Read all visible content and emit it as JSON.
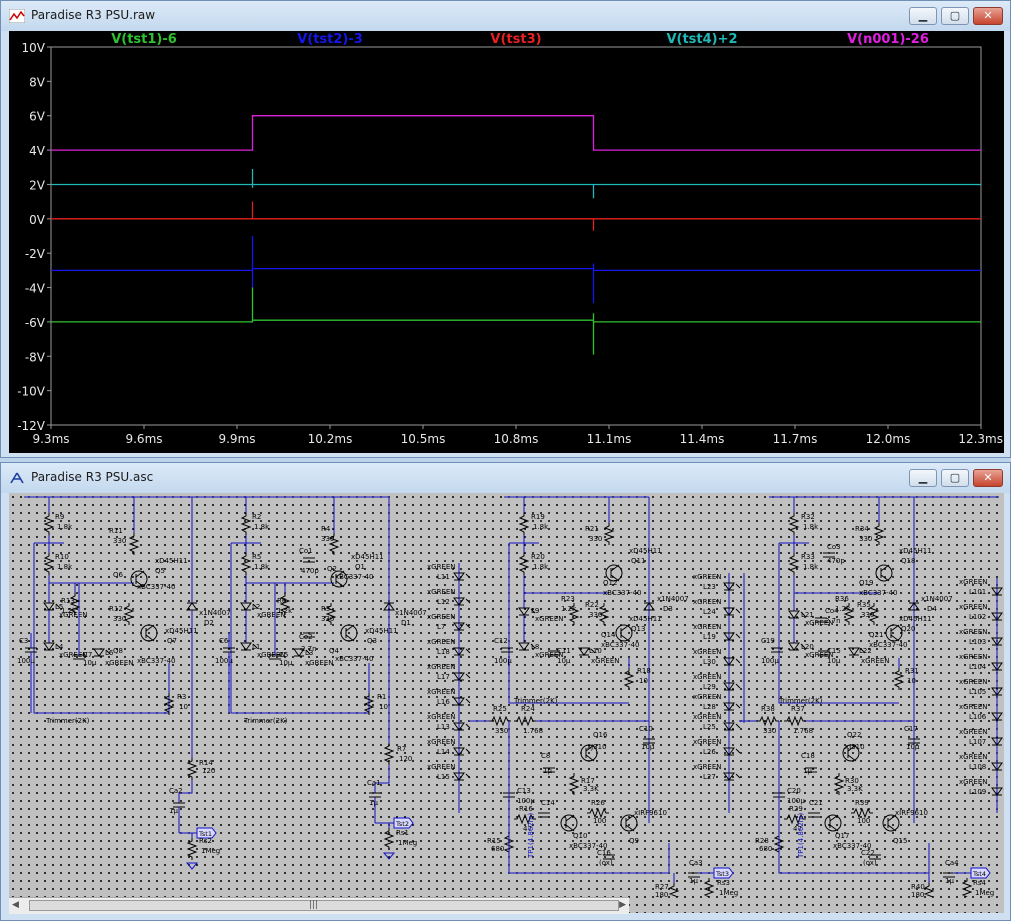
{
  "waveform_window": {
    "title": "Paradise R3 PSU.raw",
    "buttons": {
      "minimize": "▁",
      "maximize": "▢",
      "close": "✕"
    }
  },
  "schematic_window": {
    "title": "Paradise R3 PSU.asc",
    "buttons": {
      "minimize": "▁",
      "maximize": "▢",
      "close": "✕"
    },
    "labels": {
      "r9": "R9",
      "r9v": "1.8k",
      "r10": "R10",
      "r10v": "1.8k",
      "r11": "R11",
      "r11v": "330",
      "q5": "xD45H11",
      "q5n": "Q5",
      "q6": "Q6",
      "q6m": "xBC337-40",
      "r13": "R13",
      "r13v": "1.2k",
      "r12": "R12",
      "r12v": "330",
      "q7": "xD45H11",
      "q7n": "Q7",
      "q8": "Q8",
      "q8m": "xBC337-40",
      "d2": "x1N4007",
      "d2n": "D2",
      "l5": "L5",
      "l5m": "xGREEN",
      "c3": "C3",
      "c3v": "100µ",
      "l4": "L4",
      "l4m": "xGREEN",
      "c7": "C7",
      "c7v": "10µ",
      "l6": "L6",
      "l6m": "xGREEN",
      "r3": "R3",
      "r3v": "10",
      "trim1": "Trimmer(2K)",
      "r14": "R14",
      "r14v": "120",
      "ca2": "Ca2",
      "ca2v": "1µ",
      "rs2": "Rs2",
      "rs2v": "1Meg",
      "tst1": "Tst1",
      "r2": "R2",
      "r2v": "1.8k",
      "r5": "R5",
      "r5v": "1.8k",
      "r4": "R4",
      "r4v": "330",
      "co1": "Co1",
      "co1v": "470p",
      "q2": "Q2",
      "q2m": "xBC337-40",
      "q1": "xD45H11",
      "q1n": "Q1",
      "r6": "R6",
      "r6v": "1.2k",
      "r5b": "R5",
      "r5bv": "330",
      "co2": "Co2",
      "co2v": "2.7n",
      "q4": "Q4",
      "q4m": "xBC337-40",
      "q3": "xD45H11",
      "q3n": "Q3",
      "d1": "x1N4007",
      "d1n": "D1",
      "l2": "L2",
      "l2m": "xGREEN",
      "c6": "C6",
      "c6v": "100µ",
      "l1": "L1",
      "l1m": "xGREEN",
      "c5": "C5",
      "c5v": "10µ",
      "l3": "L3",
      "l3m": "xGREEN",
      "r1": "R1",
      "r1v": "10",
      "trim2": "Trimmer(2K)",
      "r7": "R7",
      "r7v": "120",
      "ca1": "Ca1",
      "ca1v": "1µ",
      "rs1": "Rs1",
      "rs1v": "1Meg",
      "tst2": "Tst2",
      "xg": "xGREEN",
      "l11": "L11",
      "l12": "L12",
      "l7": "L7",
      "l18": "L18",
      "l17": "L17",
      "l16": "L16",
      "l13": "L13",
      "l14": "L14",
      "l15": "L15",
      "r19": "R19",
      "r19v": "1.8k",
      "r20": "R20",
      "r20v": "1.8k",
      "r21": "R21",
      "r21v": "330",
      "q11": "xD45H11",
      "q11n": "Q11",
      "q12": "Q12",
      "q12m": "xBC337-40",
      "r23": "R23",
      "r23v": "1.2k",
      "r22": "R22",
      "r22v": "330",
      "q13": "xD45H11",
      "q13n": "Q13",
      "q14": "Q14",
      "q14m": "xBC337-40",
      "d3": "x1N4007",
      "d3n": "D3",
      "l9": "L9",
      "l9m": "xGREEN",
      "c12": "C12",
      "c12v": "100µ",
      "l8": "L8",
      "l8m": "xGREEN",
      "c11": "C11",
      "c11v": "10µ",
      "l10": "L10",
      "l10m": "xGREEN",
      "r18": "R18",
      "r18v": "10",
      "trim3": "Trimmer(2K)",
      "r25": "R25",
      "r25v": "330",
      "r24": "R24",
      "r24v": "1.768",
      "c10": "C10",
      "c10v": "10µ",
      "q16": "Q16",
      "q16m": "xJ310",
      "c8": "C8",
      "c8v": "1µ",
      "r17": "R17",
      "r17v": "3.3K",
      "c13": "C13",
      "c13v": "100µ",
      "c14": "C14",
      "r26": "R26",
      "r26v": "100",
      "q10": "Q10",
      "q10m": "xBC337-40",
      "q9": "Q9",
      "q9m": "xIRF9610",
      "r16": "R16",
      "r16v": "47",
      "r15": "R15",
      "r15v": "680",
      "c16": "C16",
      "c16v": "(ox)",
      "tp1": "TP1(4.862m)",
      "r27": "R27",
      "r27v": "180",
      "ca3": "Ca3",
      "ca3v": "1µ",
      "rs3": "Rs3",
      "rs3v": "1Meg",
      "tst3": "Tst3",
      "l23": "L23",
      "l24": "L24",
      "l19": "L19",
      "l30": "L30",
      "l29": "L29",
      "l28": "L28",
      "l25": "L25",
      "l26": "L26",
      "l27": "L27",
      "r32": "R32",
      "r32v": "1.8k",
      "r33": "R33",
      "r33v": "1.8k",
      "r34": "R34",
      "r34v": "330",
      "co3": "Co3",
      "co3v": "470p",
      "q19": "Q19",
      "q19m": "xBC337-40",
      "q18": "xD45H11",
      "q18n": "Q18",
      "r36": "R36",
      "r36v": "1.2k",
      "r35": "R35",
      "r35v": "330",
      "co4": "Co4",
      "co4v": "2.7n",
      "q21": "Q21",
      "q21m": "xBC337-40",
      "q20": "xD45H11",
      "q20n": "Q20",
      "d4": "x1N4007",
      "d4n": "D4",
      "l21": "L21",
      "l21m": "xGREEN",
      "c19": "C19",
      "c19v": "100µ",
      "l20": "L20",
      "l20m": "xGREEN",
      "c15": "C15",
      "c15v": "10µ",
      "l22": "L22",
      "l22m": "xGREEN",
      "r31": "R31",
      "r31v": "10",
      "trim4": "Trimmer(2K)",
      "r38": "R38",
      "r38v": "330",
      "r37": "R37",
      "r37v": "1.768",
      "c17": "C17",
      "c17v": "10µ",
      "q22": "Q22",
      "q22m": "xJ310",
      "c18": "C18",
      "c18v": "1µ",
      "r30": "R30",
      "r30v": "3.3K",
      "c20": "C20",
      "c20v": "100µ",
      "c21": "C21",
      "r39": "R39",
      "r39v": "100",
      "q17": "Q17",
      "q17m": "xBC337-40",
      "q15": "Q15",
      "q15m": "xIRF9610",
      "r29": "R29",
      "r29v": "47",
      "r28": "R28",
      "r28v": "680",
      "c22": "C22",
      "c22v": "(ox)",
      "tp2": "TP1(4.862m)",
      "r40": "R40",
      "r40v": "180",
      "ca4": "Ca4",
      "ca4v": "1µ",
      "rs4": "Rs4",
      "rs4v": "1Meg",
      "tst4": "Tst4",
      "l101": "L101",
      "l102": "L102",
      "l103": "L103",
      "l104": "L104",
      "l105": "L105",
      "l106": "L106",
      "l107": "L107",
      "l108": "L108",
      "l109": "L109"
    }
  },
  "chart_data": {
    "type": "line",
    "background": "#000000",
    "xlim": [
      9.3,
      12.3
    ],
    "ylim": [
      -12,
      10
    ],
    "x_unit": "ms",
    "y_unit": "V",
    "x_ticks": [
      "9.3ms",
      "9.6ms",
      "9.9ms",
      "10.2ms",
      "10.5ms",
      "10.8ms",
      "11.1ms",
      "11.4ms",
      "11.7ms",
      "12.0ms",
      "12.3ms"
    ],
    "x_tick_values": [
      9.3,
      9.6,
      9.9,
      10.2,
      10.5,
      10.8,
      11.1,
      11.4,
      11.7,
      12.0,
      12.3
    ],
    "y_ticks": [
      "10V",
      "8V",
      "6V",
      "4V",
      "2V",
      "0V",
      "-2V",
      "-4V",
      "-6V",
      "-8V",
      "-10V",
      "-12V"
    ],
    "y_tick_values": [
      10,
      8,
      6,
      4,
      2,
      0,
      -2,
      -4,
      -6,
      -8,
      -10,
      -12
    ],
    "grid": false,
    "legend_position": "top",
    "series": [
      {
        "name": "V(tst1)-6",
        "color": "#2ec22e",
        "x": [
          9.3,
          9.95,
          9.95,
          9.95,
          9.95,
          11.05,
          11.05,
          11.05,
          11.05,
          12.3
        ],
        "y": [
          -6,
          -6,
          -4,
          -6,
          -5.9,
          -5.9,
          -5.5,
          -7.9,
          -6,
          -6
        ]
      },
      {
        "name": "V(tst2)-3",
        "color": "#1515ee",
        "x": [
          9.3,
          9.95,
          9.95,
          9.95,
          9.95,
          11.05,
          11.05,
          11.05,
          11.05,
          12.3
        ],
        "y": [
          -3,
          -3,
          -1,
          -4,
          -2.9,
          -2.9,
          -2.6,
          -4.9,
          -3,
          -3
        ]
      },
      {
        "name": "V(tst3)",
        "color": "#e82020",
        "x": [
          9.3,
          9.95,
          9.95,
          9.95,
          9.95,
          11.05,
          11.05,
          11.05,
          11.05,
          12.3
        ],
        "y": [
          0,
          0,
          1,
          0,
          0,
          0,
          0,
          -0.7,
          0,
          0
        ]
      },
      {
        "name": "V(tst4)+2",
        "color": "#20b8b8",
        "x": [
          9.3,
          9.95,
          9.95,
          9.95,
          9.95,
          11.05,
          11.05,
          11.05,
          11.05,
          12.3
        ],
        "y": [
          2,
          2,
          2.9,
          1.8,
          2,
          2,
          2,
          1.2,
          2,
          2
        ]
      },
      {
        "name": "V(n001)-26",
        "color": "#e020e0",
        "x": [
          9.3,
          9.95,
          9.95,
          11.05,
          11.05,
          12.3
        ],
        "y": [
          4,
          4,
          6,
          6,
          4,
          4
        ]
      }
    ]
  }
}
